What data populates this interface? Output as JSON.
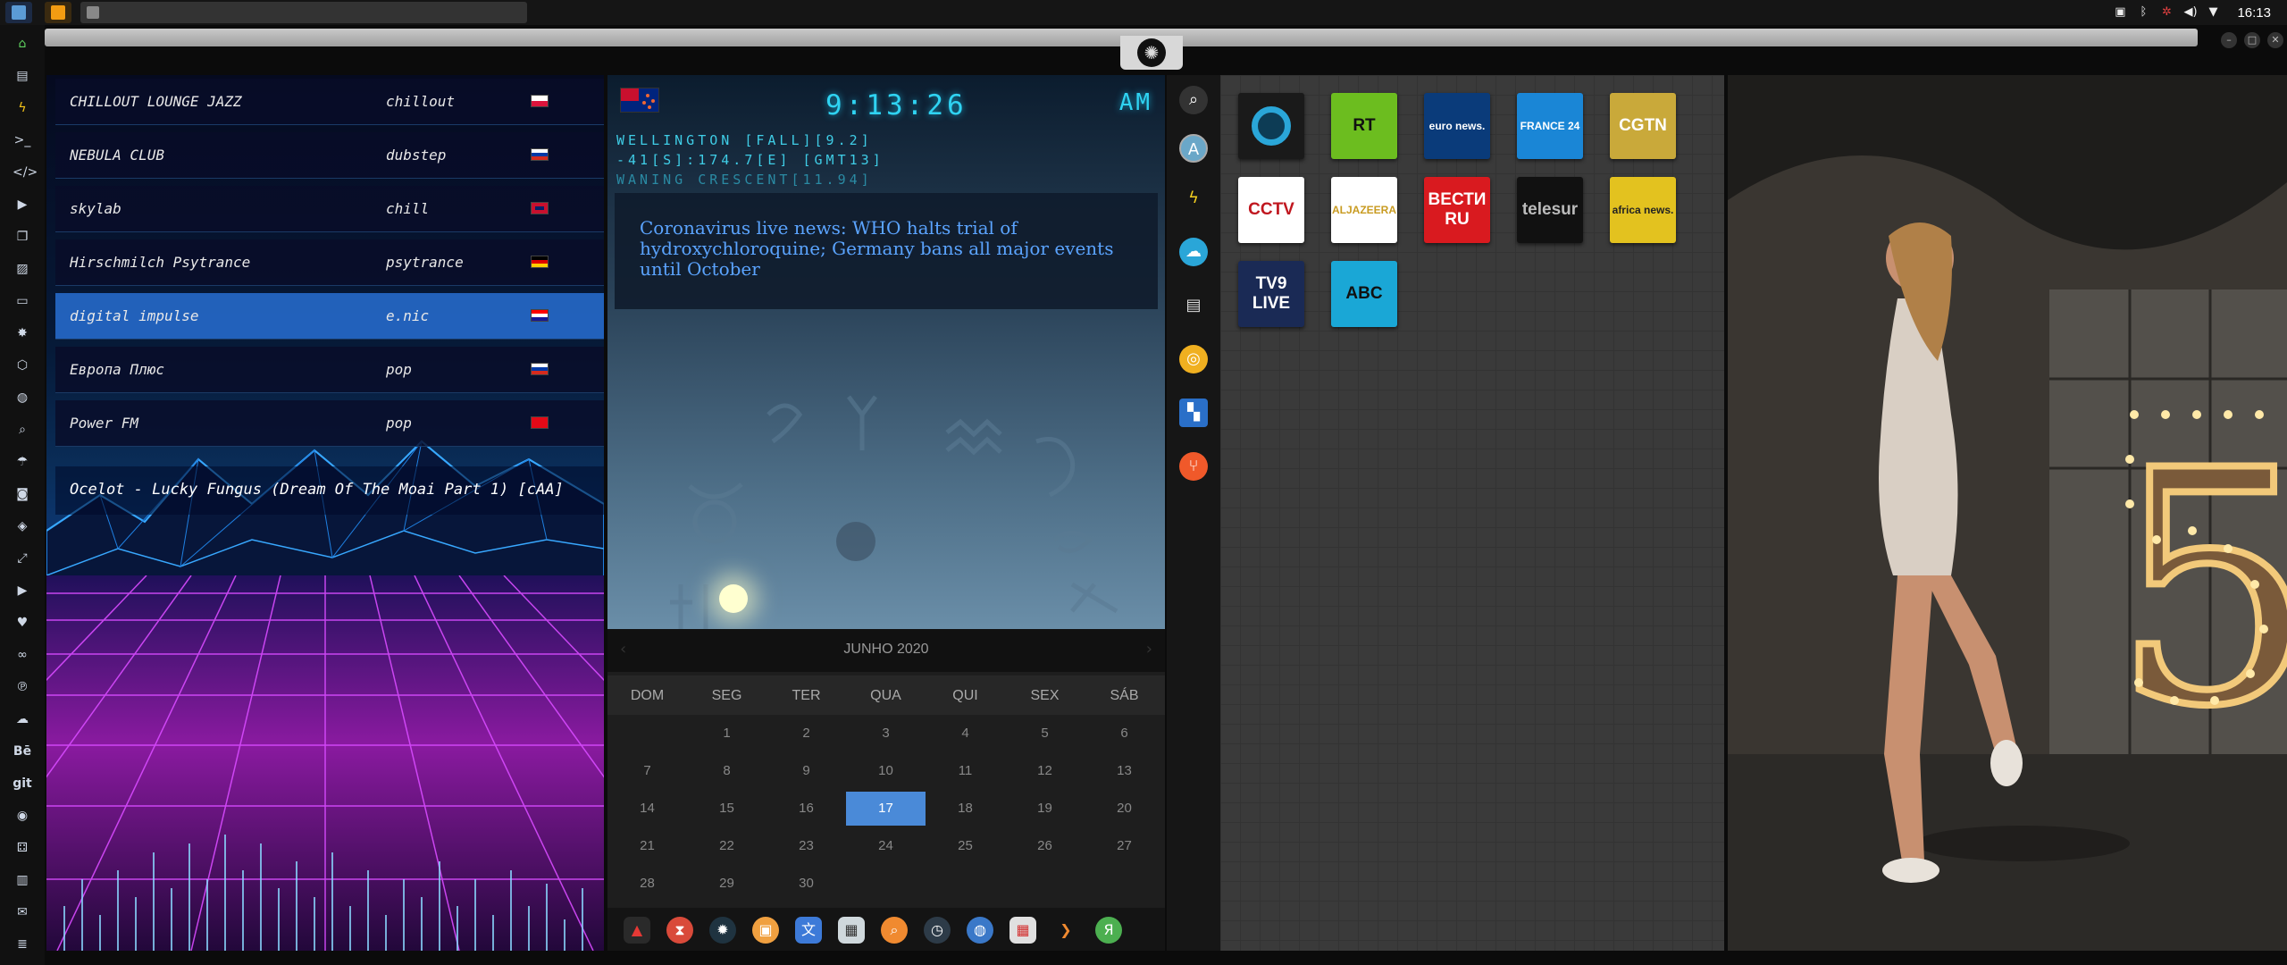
{
  "top_panel": {
    "clock": "16:13"
  },
  "radio": {
    "stations": [
      {
        "name": "CHILLOUT LOUNGE JAZZ",
        "genre": "chillout",
        "flag": "pl"
      },
      {
        "name": "NEBULA CLUB",
        "genre": "dubstep",
        "flag": "ru"
      },
      {
        "name": "skylab",
        "genre": "chill",
        "flag": "gb"
      },
      {
        "name": "Hirschmilch Psytrance",
        "genre": "psytrance",
        "flag": "de"
      },
      {
        "name": "digital impulse",
        "genre": "e.nic",
        "flag": "hr"
      },
      {
        "name": "Европа Плюс",
        "genre": "pop",
        "flag": "ru"
      },
      {
        "name": "Power FM",
        "genre": "pop",
        "flag": "tr"
      }
    ],
    "now_playing": "Ocelot - Lucky Fungus (Dream Of The Moai Part 1) [cAA]"
  },
  "world_clock": {
    "time": "9:13:26",
    "ampm": "AM",
    "location": "WELLINGTON [FALL][9.2]",
    "coords": "-41[S]:174.7[E] [GMT13]",
    "moon_phase": "WANING CRESCENT[11.94]",
    "news": "Coronavirus live news: WHO halts trial of hydroxychloroquine; Germany bans all major events until October"
  },
  "calendar": {
    "month": "JUNHO 2020",
    "weekdays": [
      "DOM",
      "SEG",
      "TER",
      "QUA",
      "QUI",
      "SEX",
      "SÁB"
    ],
    "weeks": [
      [
        "",
        "1",
        "2",
        "3",
        "4",
        "5",
        "6"
      ],
      [
        "7",
        "8",
        "9",
        "10",
        "11",
        "12",
        "13"
      ],
      [
        "14",
        "15",
        "16",
        "17",
        "18",
        "19",
        "20"
      ],
      [
        "21",
        "22",
        "23",
        "24",
        "25",
        "26",
        "27"
      ],
      [
        "28",
        "29",
        "30",
        "",
        "",
        "",
        ""
      ]
    ],
    "today": "17"
  },
  "tv_channels": [
    {
      "label": "",
      "bg": "#1a1a1a",
      "fg": "#2aa6d8"
    },
    {
      "label": "RT",
      "bg": "#6cbd1f",
      "fg": "#111"
    },
    {
      "label": "euro news.",
      "bg": "#0a3b7a",
      "fg": "#fff"
    },
    {
      "label": "FRANCE 24",
      "bg": "#1a86d6",
      "fg": "#fff"
    },
    {
      "label": "CGTN",
      "bg": "#c9a93a",
      "fg": "#fff"
    },
    {
      "label": "CCTV",
      "bg": "#ffffff",
      "fg": "#c0171f"
    },
    {
      "label": "ALJAZEERA",
      "bg": "#ffffff",
      "fg": "#c89b21"
    },
    {
      "label": "ВЕСТИ RU",
      "bg": "#d91a1f",
      "fg": "#fff"
    },
    {
      "label": "telesur",
      "bg": "#111111",
      "fg": "#bbb"
    },
    {
      "label": "africa news.",
      "bg": "#e3c21f",
      "fg": "#222"
    },
    {
      "label": "TV9 LIVE",
      "bg": "#1a2a55",
      "fg": "#fff"
    },
    {
      "label": "ABC",
      "bg": "#1aa7d6",
      "fg": "#111"
    }
  ]
}
